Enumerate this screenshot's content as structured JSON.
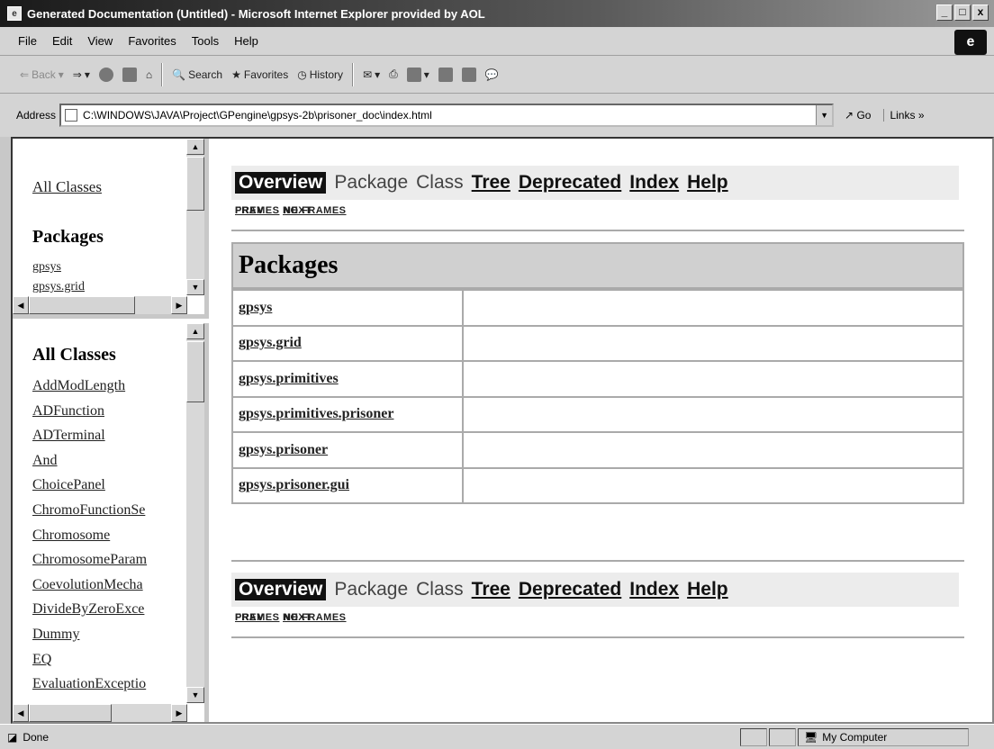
{
  "window": {
    "title": "Generated Documentation (Untitled) - Microsoft Internet Explorer provided by AOL",
    "controls": [
      "_",
      "□",
      "x"
    ]
  },
  "menu": [
    "File",
    "Edit",
    "View",
    "Favorites",
    "Tools",
    "Help"
  ],
  "toolbar": {
    "back": "Back",
    "search": "Search",
    "favorites": "Favorites",
    "history": "History"
  },
  "address": {
    "label": "Address",
    "url": "C:\\WINDOWS\\JAVA\\Project\\GPengine\\gpsys-2b\\prisoner_doc\\index.html",
    "go": "Go",
    "links": "Links"
  },
  "left_top": {
    "all_classes_link": "All Classes",
    "packages_heading": "Packages",
    "packages": [
      "gpsys",
      "gpsys.grid"
    ]
  },
  "left_bottom": {
    "heading": "All Classes",
    "classes": [
      "AddModLength",
      "ADFunction",
      "ADTerminal",
      "And",
      "ChoicePanel",
      "ChromoFunctionSe",
      "Chromosome",
      "ChromosomeParam",
      "CoevolutionMecha",
      "DivideByZeroExce",
      "Dummy",
      "EQ",
      "EvaluationExceptio"
    ]
  },
  "nav": {
    "overview": "Overview",
    "package": "Package",
    "class": "Class",
    "tree": "Tree",
    "deprecated": "Deprecated",
    "index": "Index",
    "help": "Help",
    "prev": "PREV",
    "next": "NEXT",
    "frames": "FRAMES",
    "no_frames": "NO FRAMES"
  },
  "packages_table": {
    "heading": "Packages",
    "rows": [
      "gpsys",
      "gpsys.grid",
      "gpsys.primitives",
      "gpsys.primitives.prisoner",
      "gpsys.prisoner",
      "gpsys.prisoner.gui"
    ]
  },
  "status": {
    "text": "Done",
    "zone": "My Computer"
  }
}
